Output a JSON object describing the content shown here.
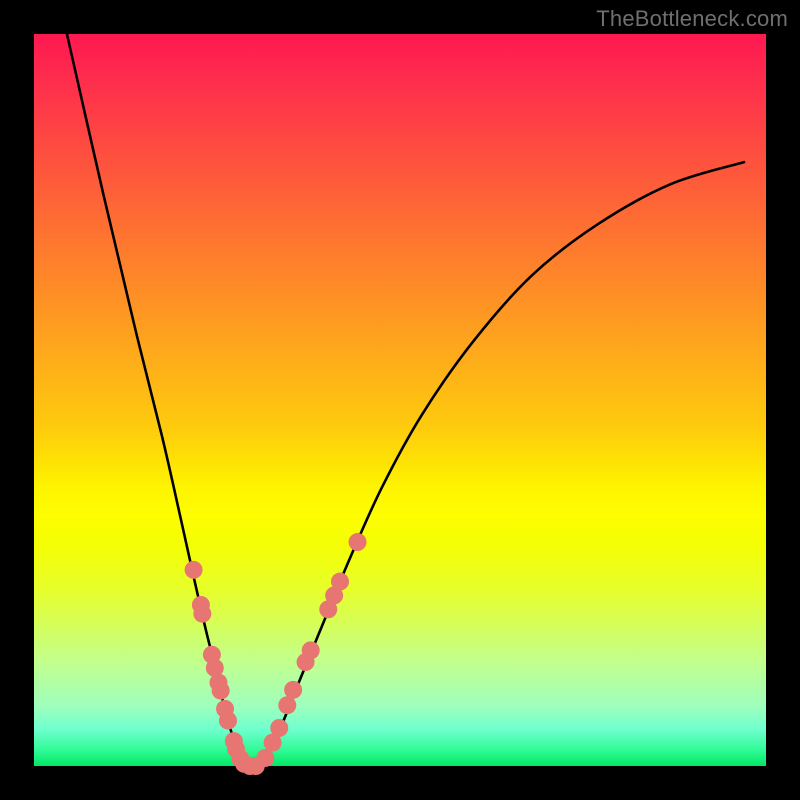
{
  "watermark": "TheBottleneck.com",
  "chart_data": {
    "type": "line",
    "title": "",
    "xlabel": "",
    "ylabel": "",
    "xlim": [
      0,
      1
    ],
    "ylim": [
      0,
      1
    ],
    "legend": false,
    "grid": false,
    "background": "rainbow-vertical-gradient",
    "series": [
      {
        "name": "bottleneck-curve",
        "x": [
          0.045,
          0.095,
          0.14,
          0.175,
          0.2,
          0.22,
          0.235,
          0.25,
          0.26,
          0.27,
          0.278,
          0.285,
          0.3,
          0.32,
          0.34,
          0.36,
          0.395,
          0.43,
          0.475,
          0.53,
          0.6,
          0.68,
          0.77,
          0.87,
          0.97
        ],
        "y": [
          1.0,
          0.78,
          0.59,
          0.45,
          0.34,
          0.25,
          0.185,
          0.125,
          0.08,
          0.045,
          0.02,
          0.0,
          0.0,
          0.02,
          0.06,
          0.11,
          0.195,
          0.28,
          0.38,
          0.48,
          0.58,
          0.67,
          0.74,
          0.795,
          0.825
        ]
      }
    ],
    "markers": [
      {
        "name": "cluster-points",
        "color": "#e77672",
        "radius_px": 9,
        "points": [
          {
            "x": 0.218,
            "y": 0.268
          },
          {
            "x": 0.228,
            "y": 0.22
          },
          {
            "x": 0.23,
            "y": 0.208
          },
          {
            "x": 0.243,
            "y": 0.152
          },
          {
            "x": 0.247,
            "y": 0.134
          },
          {
            "x": 0.252,
            "y": 0.114
          },
          {
            "x": 0.255,
            "y": 0.103
          },
          {
            "x": 0.261,
            "y": 0.078
          },
          {
            "x": 0.265,
            "y": 0.062
          },
          {
            "x": 0.273,
            "y": 0.034
          },
          {
            "x": 0.276,
            "y": 0.023
          },
          {
            "x": 0.282,
            "y": 0.01
          },
          {
            "x": 0.287,
            "y": 0.003
          },
          {
            "x": 0.295,
            "y": 0.0
          },
          {
            "x": 0.303,
            "y": 0.0
          },
          {
            "x": 0.316,
            "y": 0.011
          },
          {
            "x": 0.326,
            "y": 0.032
          },
          {
            "x": 0.335,
            "y": 0.052
          },
          {
            "x": 0.346,
            "y": 0.083
          },
          {
            "x": 0.354,
            "y": 0.104
          },
          {
            "x": 0.371,
            "y": 0.142
          },
          {
            "x": 0.378,
            "y": 0.158
          },
          {
            "x": 0.402,
            "y": 0.214
          },
          {
            "x": 0.41,
            "y": 0.233
          },
          {
            "x": 0.418,
            "y": 0.252
          },
          {
            "x": 0.442,
            "y": 0.306
          }
        ]
      }
    ]
  }
}
